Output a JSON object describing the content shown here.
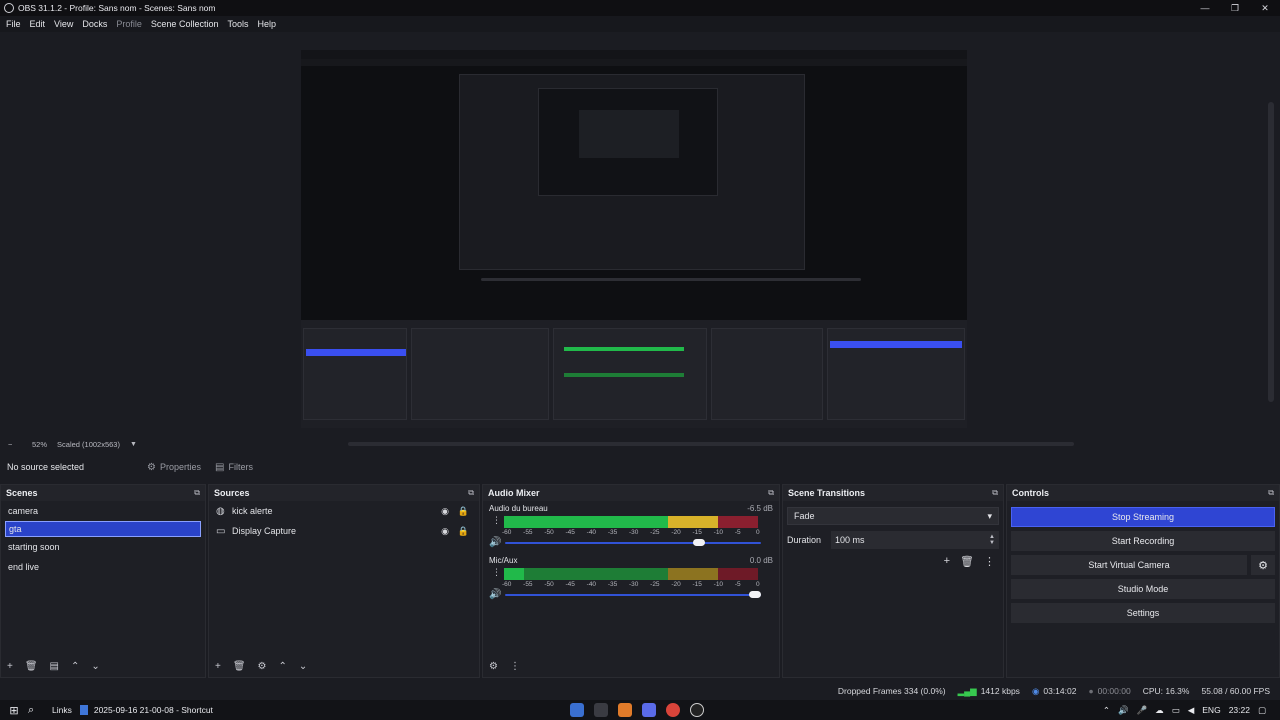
{
  "window": {
    "title": "OBS 31.1.2 - Profile: Sans nom - Scenes: Sans nom",
    "controls": [
      "—",
      "❐",
      "✕"
    ]
  },
  "menu": {
    "items": [
      {
        "label": "File",
        "enabled": true
      },
      {
        "label": "Edit",
        "enabled": true
      },
      {
        "label": "View",
        "enabled": true
      },
      {
        "label": "Docks",
        "enabled": true
      },
      {
        "label": "Profile",
        "enabled": false
      },
      {
        "label": "Scene Collection",
        "enabled": true
      },
      {
        "label": "Tools",
        "enabled": true
      },
      {
        "label": "Help",
        "enabled": true
      }
    ]
  },
  "zoom": {
    "minus": "−",
    "value": "52%",
    "scale": "Scaled (1002x563)",
    "arrow": "▼"
  },
  "source_toolbar": {
    "no_source": "No source selected",
    "properties": "Properties",
    "filters": "Filters"
  },
  "scenes": {
    "title": "Scenes",
    "items": [
      "camera",
      "gta",
      "starting soon",
      "end live"
    ],
    "selected_index": 1
  },
  "sources": {
    "title": "Sources",
    "items": [
      {
        "label": "kick alerte",
        "icon": "browser-icon"
      },
      {
        "label": "Display Capture",
        "icon": "monitor-icon"
      }
    ]
  },
  "mixer": {
    "title": "Audio Mixer",
    "ticks": [
      "-60",
      "-55",
      "-50",
      "-45",
      "-40",
      "-35",
      "-30",
      "-25",
      "-20",
      "-15",
      "-10",
      "-5",
      "0"
    ],
    "channels": [
      {
        "name": "Audio du bureau",
        "db": "-6.5 dB",
        "level": 0.92,
        "volume": 0.78
      },
      {
        "name": "Mic/Aux",
        "db": "0.0 dB",
        "level": 0.08,
        "volume": 1.0
      }
    ]
  },
  "transitions": {
    "title": "Scene Transitions",
    "selected": "Fade",
    "duration_label": "Duration",
    "duration_value": "100 ms"
  },
  "controls": {
    "title": "Controls",
    "stop_streaming": "Stop Streaming",
    "start_recording": "Start Recording",
    "start_virtual_camera": "Start Virtual Camera",
    "studio_mode": "Studio Mode",
    "settings": "Settings"
  },
  "status": {
    "dropped_frames": "Dropped Frames 334 (0.0%)",
    "bitrate": "1412 kbps",
    "stream_time": "03:14:02",
    "rec_time": "00:00:00",
    "cpu": "CPU: 16.3%",
    "fps": "55.08 / 60.00 FPS"
  },
  "taskbar": {
    "links": "Links",
    "shortcut": "2025-09-16 21-00-08 - Shortcut",
    "lang": "ENG",
    "time": "23:22"
  },
  "colors": {
    "accent": "#2f45d3",
    "meter_green": "#21b94a",
    "meter_yellow": "#d8b22a",
    "meter_red": "#c7273a"
  }
}
